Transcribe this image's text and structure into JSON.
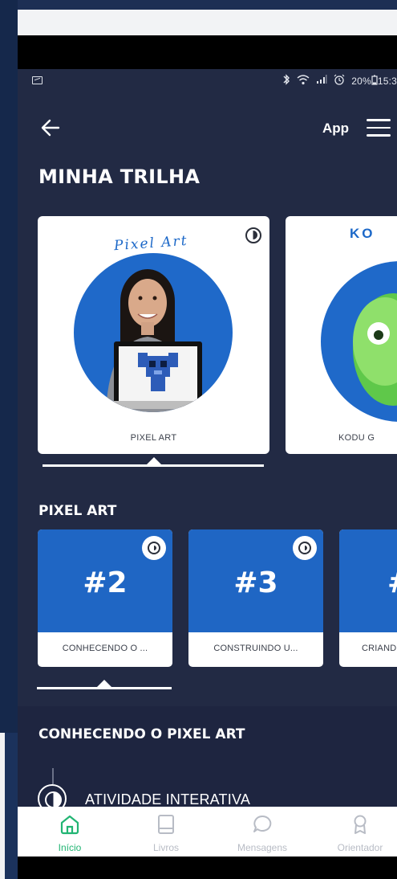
{
  "status_bar": {
    "battery": "20%",
    "time": "15:3"
  },
  "header": {
    "app_label": "App"
  },
  "trilha": {
    "title": "MINHA TRILHA",
    "cards": [
      {
        "art_title": "Pixel Art",
        "caption": "PIXEL ART"
      },
      {
        "art_title": "KO",
        "caption": "KODU G"
      }
    ]
  },
  "pixel_art": {
    "title": "PIXEL ART",
    "lessons": [
      {
        "number": "#2",
        "label": "CONHECENDO O ..."
      },
      {
        "number": "#3",
        "label": "CONSTRUINDO U..."
      },
      {
        "number": "#",
        "label": "CRIAND"
      }
    ]
  },
  "activity_section": {
    "title": "CONHECENDO O PIXEL ART",
    "activity_label": "ATIVIDADE INTERATIVA"
  },
  "bottom_nav": {
    "items": [
      {
        "label": "Início",
        "icon": "home-icon",
        "active": true
      },
      {
        "label": "Livros",
        "icon": "book-icon",
        "active": false
      },
      {
        "label": "Mensagens",
        "icon": "chat-icon",
        "active": false
      },
      {
        "label": "Orientador",
        "icon": "badge-icon",
        "active": false
      }
    ]
  },
  "colors": {
    "screen_bg": "#222a44",
    "accent_blue": "#1f66c4",
    "active_green": "#22b573"
  }
}
